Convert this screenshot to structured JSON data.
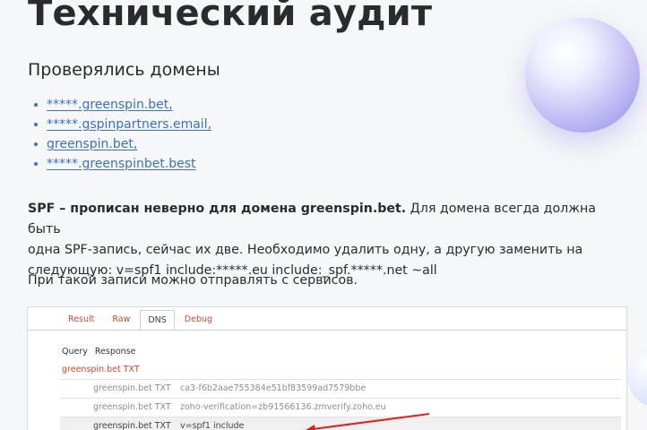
{
  "heading": "Технический аудит",
  "subheading": "Проверялись домены",
  "domains": [
    "*****.greenspin.bet,",
    "*****.gspinpartners.email,",
    "greenspin.bet,",
    "*****.greenspinbet.best"
  ],
  "spf": {
    "bold": "SPF – прописан неверно для домена greenspin.bet.",
    "line1_rest": " Для домена всегда должна быть",
    "line2": "одна SPF-запись, сейчас их две. Необходимо удалить одну, а другую заменить на",
    "line3": "следующую: v=spf1 include:*****.eu include:_spf.*****.net ~all"
  },
  "note": "При такой записи можно отправлять с сервисов.",
  "screenshot": {
    "tabs": [
      "Result",
      "Raw",
      "DNS",
      "Debug"
    ],
    "active_tab": "DNS",
    "columns": [
      "Query",
      "Response"
    ],
    "zone": "greenspin.bet TXT",
    "rows": [
      {
        "name": "greenspin.bet TXT",
        "value": "ca3-f6b2aae755384e51bf83599ad7579bbe"
      },
      {
        "name": "greenspin.bet TXT",
        "value": "zoho-verification=zb91566136.zmverify.zoho.eu"
      },
      {
        "name": "greenspin.bet TXT",
        "value": "v=spf1 include"
      }
    ],
    "arrow_color": "#e02020"
  }
}
